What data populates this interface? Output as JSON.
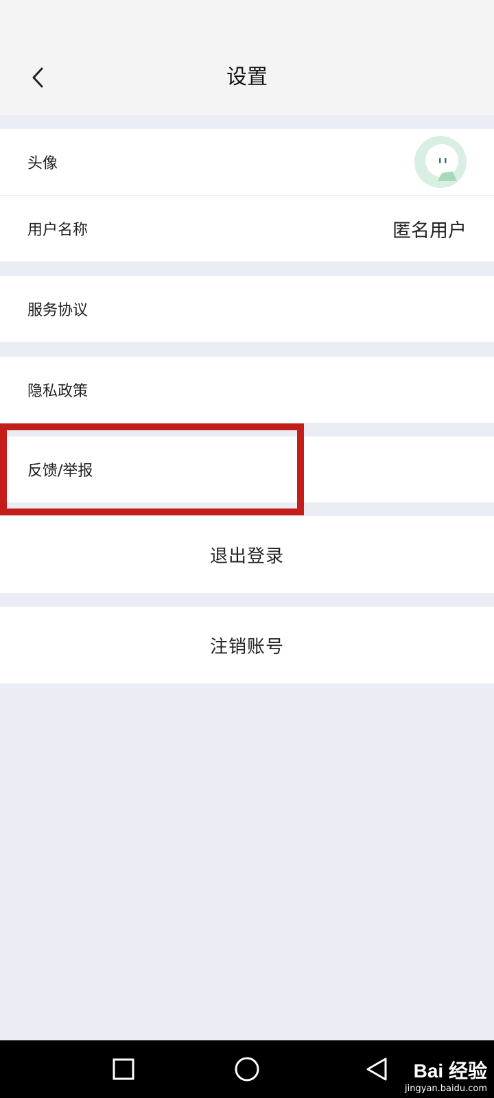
{
  "header": {
    "title": "设置",
    "back_icon": "chevron-left-icon"
  },
  "profile": {
    "avatar_label": "头像",
    "avatar_icon": "avatar-icon",
    "username_label": "用户名称",
    "username_value": "匿名用户"
  },
  "menu": {
    "service_agreement": "服务协议",
    "privacy_policy": "隐私政策",
    "feedback_report": "反馈/举报"
  },
  "actions": {
    "logout": "退出登录",
    "delete_account": "注销账号"
  },
  "navbar": {
    "recent_icon": "square-icon",
    "home_icon": "circle-icon",
    "back_icon": "triangle-back-icon"
  },
  "watermark": {
    "logo": "Bai 经验",
    "url": "jingyan.baidu.com"
  },
  "colors": {
    "highlight": "#c41e1a",
    "background": "#ebedf5",
    "header": "#f4f4f4",
    "avatar_bg": "#d9efe2"
  }
}
